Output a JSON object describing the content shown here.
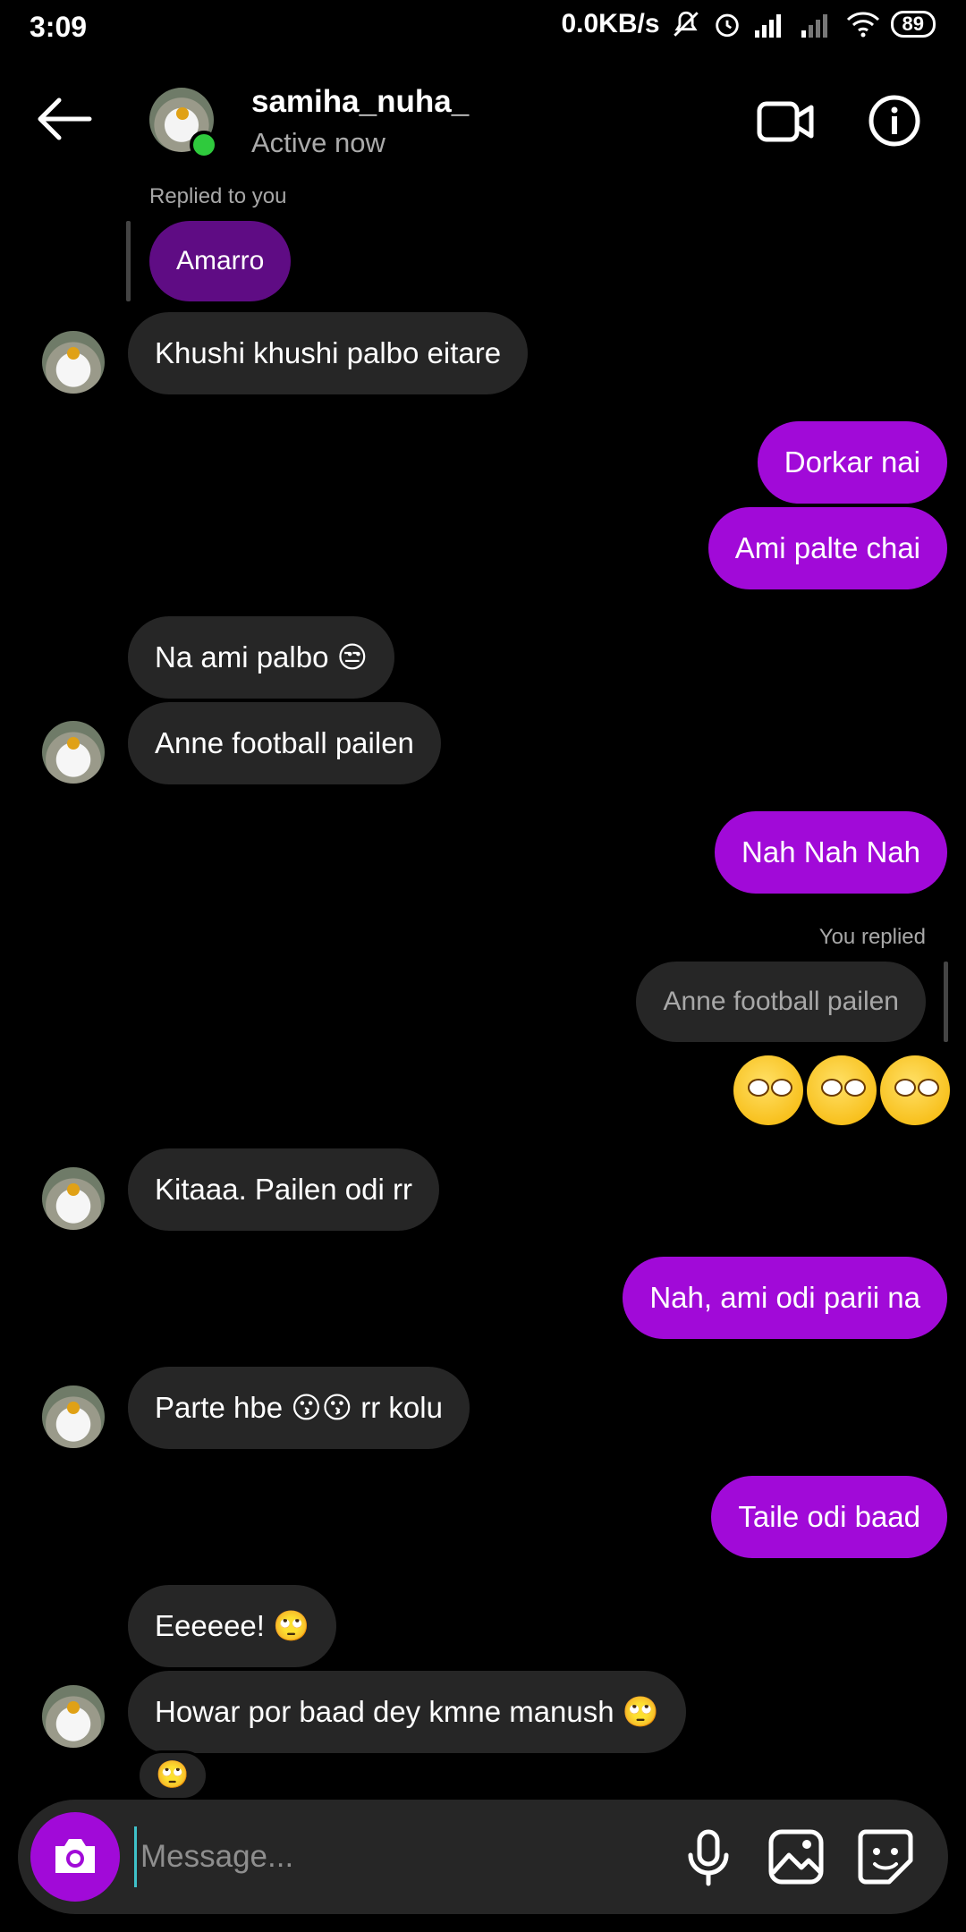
{
  "status_bar": {
    "time": "3:09",
    "net_speed": "0.0KB/s",
    "battery": "89"
  },
  "header": {
    "username": "samiha_nuha_",
    "status": "Active now"
  },
  "messages": {
    "m0_meta": "Replied to you",
    "m0_quote": "Amarro",
    "m1": "Khushi khushi palbo eitare",
    "m2": "Dorkar nai",
    "m3": "Ami palte chai",
    "m4": "Na ami palbo 😒",
    "m5": "Anne football pailen",
    "m6": "Nah Nah Nah",
    "m7_meta": "You replied",
    "m7_quote": "Anne football pailen",
    "m8": "Kitaaa. Pailen odi rr",
    "m9": "Nah, ami odi parii na",
    "m10": "Parte hbe 😗😗 rr kolu",
    "m11": "Taile odi baad",
    "m12": "Eeeeee! 🙄",
    "m13": "Howar por baad dey kmne manush 🙄",
    "reaction": "🙄"
  },
  "composer": {
    "placeholder": "Message..."
  },
  "colors": {
    "outgoing": "#a10ad8",
    "incoming": "#262626",
    "online": "#2fca3d"
  }
}
